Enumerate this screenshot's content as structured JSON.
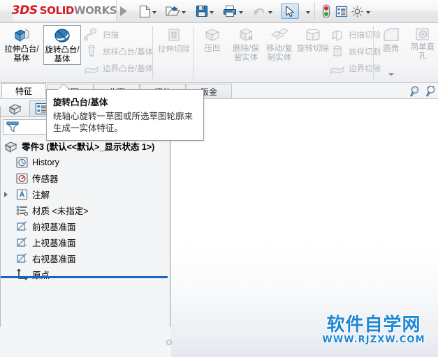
{
  "app": {
    "brand_ds": "3DS",
    "brand_solid": "SOLID",
    "brand_works": "WORKS",
    "accent_color": "#d71920",
    "selection_color": "#1767c0"
  },
  "quick_access": {
    "items": [
      {
        "name": "new-document",
        "icon": "new-file-icon",
        "has_caret": true
      },
      {
        "name": "open-document",
        "icon": "open-folder-icon",
        "has_caret": true
      },
      {
        "name": "save-document",
        "icon": "floppy-save-icon",
        "has_caret": true
      },
      {
        "name": "print-document",
        "icon": "printer-icon",
        "has_caret": true
      },
      {
        "name": "undo",
        "icon": "undo-arrow-icon",
        "has_caret": true
      },
      {
        "name": "select-tool",
        "icon": "cursor-arrow-icon",
        "has_caret": true,
        "selected": true
      },
      {
        "name": "rebuild",
        "icon": "traffic-light-icon",
        "has_caret": false
      },
      {
        "name": "options-list",
        "icon": "list-panel-icon",
        "has_caret": false
      },
      {
        "name": "settings",
        "icon": "gear-icon",
        "has_caret": true
      }
    ]
  },
  "ribbon": {
    "groups": [
      {
        "name": "boss-base-group",
        "big_buttons": [
          {
            "label": "拉伸凸台/基体",
            "icon": "extrude-boss-icon",
            "state": "enabled",
            "active": false
          },
          {
            "label": "旋转凸台/基体",
            "icon": "revolve-boss-icon",
            "state": "enabled",
            "active": true
          }
        ],
        "small_buttons": [
          {
            "label": "扫描",
            "icon": "sweep-icon",
            "state": "disabled"
          },
          {
            "label": "放样凸台/基体",
            "icon": "loft-boss-icon",
            "state": "disabled"
          },
          {
            "label": "边界凸台/基体",
            "icon": "boundary-boss-icon",
            "state": "disabled"
          }
        ]
      },
      {
        "name": "cut-group",
        "big_buttons": [
          {
            "label": "拉伸切除",
            "icon": "extrude-cut-icon",
            "state": "disabled",
            "active": false
          },
          {
            "label": "压凹",
            "icon": "indent-icon",
            "state": "disabled",
            "active": false
          },
          {
            "label": "删除/保留实体",
            "icon": "delete-keep-body-icon",
            "state": "disabled",
            "active": false
          },
          {
            "label": "移动/复制实体",
            "icon": "move-copy-body-icon",
            "state": "disabled",
            "active": false
          },
          {
            "label": "旋转切除",
            "icon": "revolve-cut-icon",
            "state": "disabled",
            "active": false
          }
        ],
        "small_buttons": [
          {
            "label": "扫描切除",
            "icon": "sweep-cut-icon",
            "state": "disabled"
          },
          {
            "label": "放样切割",
            "icon": "loft-cut-icon",
            "state": "disabled"
          },
          {
            "label": "边界切除",
            "icon": "boundary-cut-icon",
            "state": "disabled"
          }
        ]
      },
      {
        "name": "fillet-group",
        "big_buttons": [
          {
            "label": "圆角",
            "icon": "fillet-icon",
            "state": "disabled",
            "active": false
          },
          {
            "label": "简单直孔",
            "icon": "simple-hole-icon",
            "state": "disabled",
            "active": false
          }
        ],
        "small_buttons": [],
        "has_overflow_caret": true
      }
    ],
    "right_icons": [
      {
        "name": "zoom-to-fit-icon"
      },
      {
        "name": "zoom-to-area-icon"
      }
    ]
  },
  "tabs": {
    "active": "特征",
    "items": [
      "特征",
      "草图",
      "曲面",
      "评估",
      "钣金"
    ]
  },
  "left_panel": {
    "panel_tabs": [
      {
        "name": "feature-manager-tab",
        "icon": "part-tree-icon",
        "selected": false
      },
      {
        "name": "property-manager-tab",
        "icon": "property-list-icon",
        "selected": true
      }
    ],
    "filter": {
      "icon": "filter-funnel-icon",
      "value": "",
      "placeholder": ""
    },
    "tree": [
      {
        "label": "零件3  (默认<<默认>_显示状态 1>)",
        "icon": "part-icon",
        "indent": 0,
        "bold": true,
        "expander": false
      },
      {
        "label": "History",
        "icon": "history-icon",
        "indent": 1,
        "bold": false,
        "expander": false
      },
      {
        "label": "传感器",
        "icon": "sensor-icon",
        "indent": 1,
        "bold": false,
        "expander": false
      },
      {
        "label": "注解",
        "icon": "annotations-icon",
        "indent": 1,
        "bold": false,
        "expander": true
      },
      {
        "label": "材质 <未指定>",
        "icon": "material-icon",
        "indent": 1,
        "bold": false,
        "expander": false
      },
      {
        "label": "前视基准面",
        "icon": "plane-icon",
        "indent": 1,
        "bold": false,
        "expander": false
      },
      {
        "label": "上视基准面",
        "icon": "plane-icon",
        "indent": 1,
        "bold": false,
        "expander": false
      },
      {
        "label": "右视基准面",
        "icon": "plane-icon",
        "indent": 1,
        "bold": false,
        "expander": false
      },
      {
        "label": "原点",
        "icon": "origin-icon",
        "indent": 1,
        "bold": false,
        "expander": false
      }
    ]
  },
  "tooltip": {
    "title": "旋转凸台/基体",
    "body": "绕轴心旋转一草图或所选草图轮廓来生成一实体特征。"
  },
  "watermark": {
    "main": "软件自学网",
    "sub": "WWW.RJZXW.COM",
    "color": "#1e87d6"
  }
}
